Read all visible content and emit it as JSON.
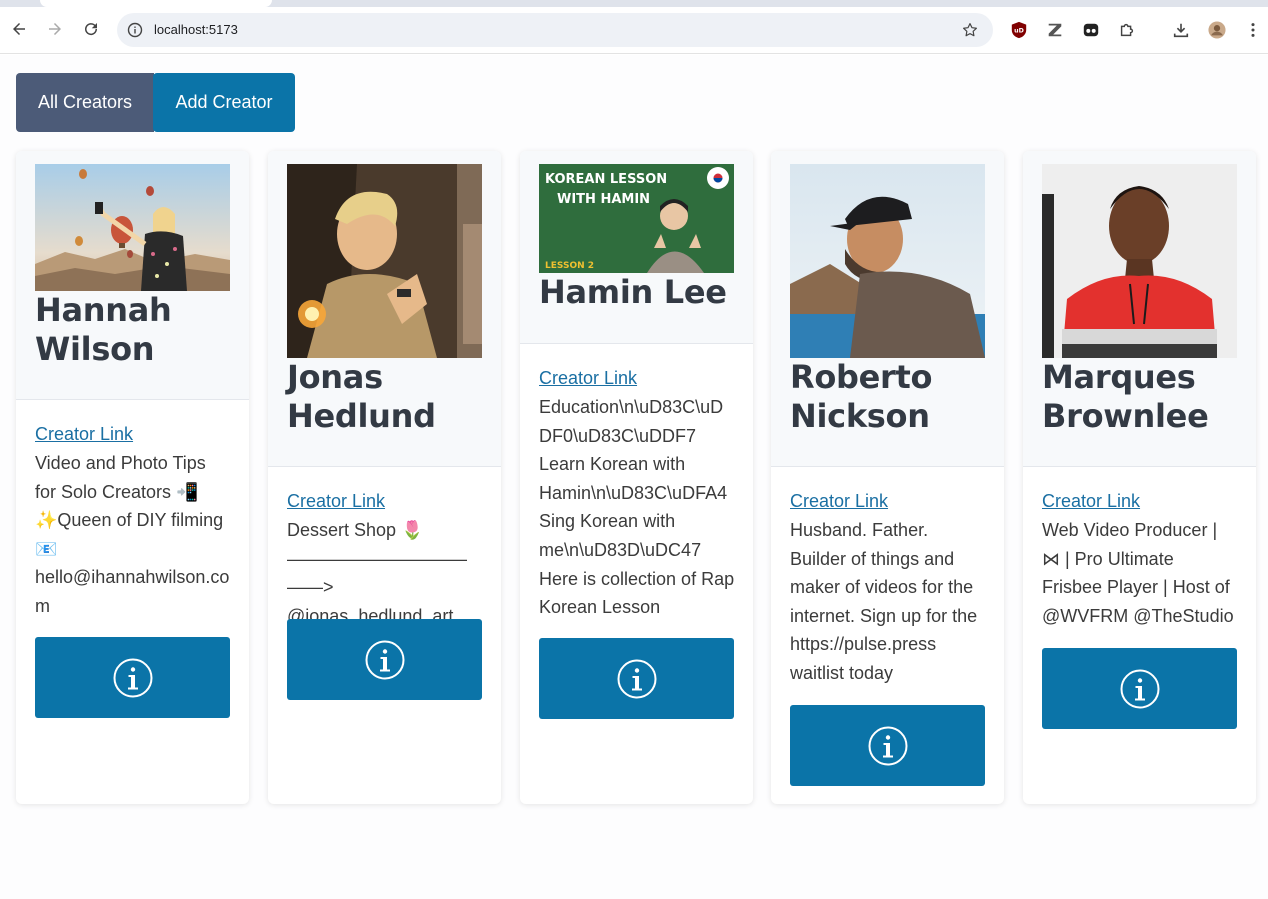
{
  "browser": {
    "url": "localhost:5173"
  },
  "nav": {
    "all_label": "All Creators",
    "add_label": "Add Creator"
  },
  "creators": [
    {
      "name": "Hannah Wilson",
      "link_label": "Creator Link",
      "description": "Video and Photo Tips for Solo Creators 📲✨Queen of DIY filming 📧hello@ihannahwilson.com"
    },
    {
      "name": "Jonas Hedlund",
      "link_label": "Creator Link",
      "description": "Dessert Shop 🌷 ————————————> @jonas_hedlund_art"
    },
    {
      "name": "Hamin Lee",
      "link_label": "Creator Link",
      "description": "Education\\n\\uD83C\\uDDF0\\uD83C\\uDDF7 Learn Korean with Hamin\\n\\uD83C\\uDFA4 Sing Korean with me\\n\\uD83D\\uDC47 Here is collection of Rap Korean Lesson",
      "thumb_line1": "KOREAN LESSON",
      "thumb_line2": "WITH HAMIN",
      "thumb_tag": "LESSON 2"
    },
    {
      "name": "Roberto Nickson",
      "link_label": "Creator Link",
      "description": "Husband. Father. Builder of things and maker of videos for the internet. Sign up for the https://pulse.press waitlist today"
    },
    {
      "name": "Marques Brownlee",
      "link_label": "Creator Link",
      "description": "Web Video Producer | ⋈ | Pro Ultimate Frisbee Player | Host of @WVFRM @TheStudio"
    }
  ],
  "colors": {
    "all_button": "#4c5b78",
    "add_button": "#0b74a8",
    "info_button": "#0b74a8",
    "link": "#1a6fa3"
  }
}
